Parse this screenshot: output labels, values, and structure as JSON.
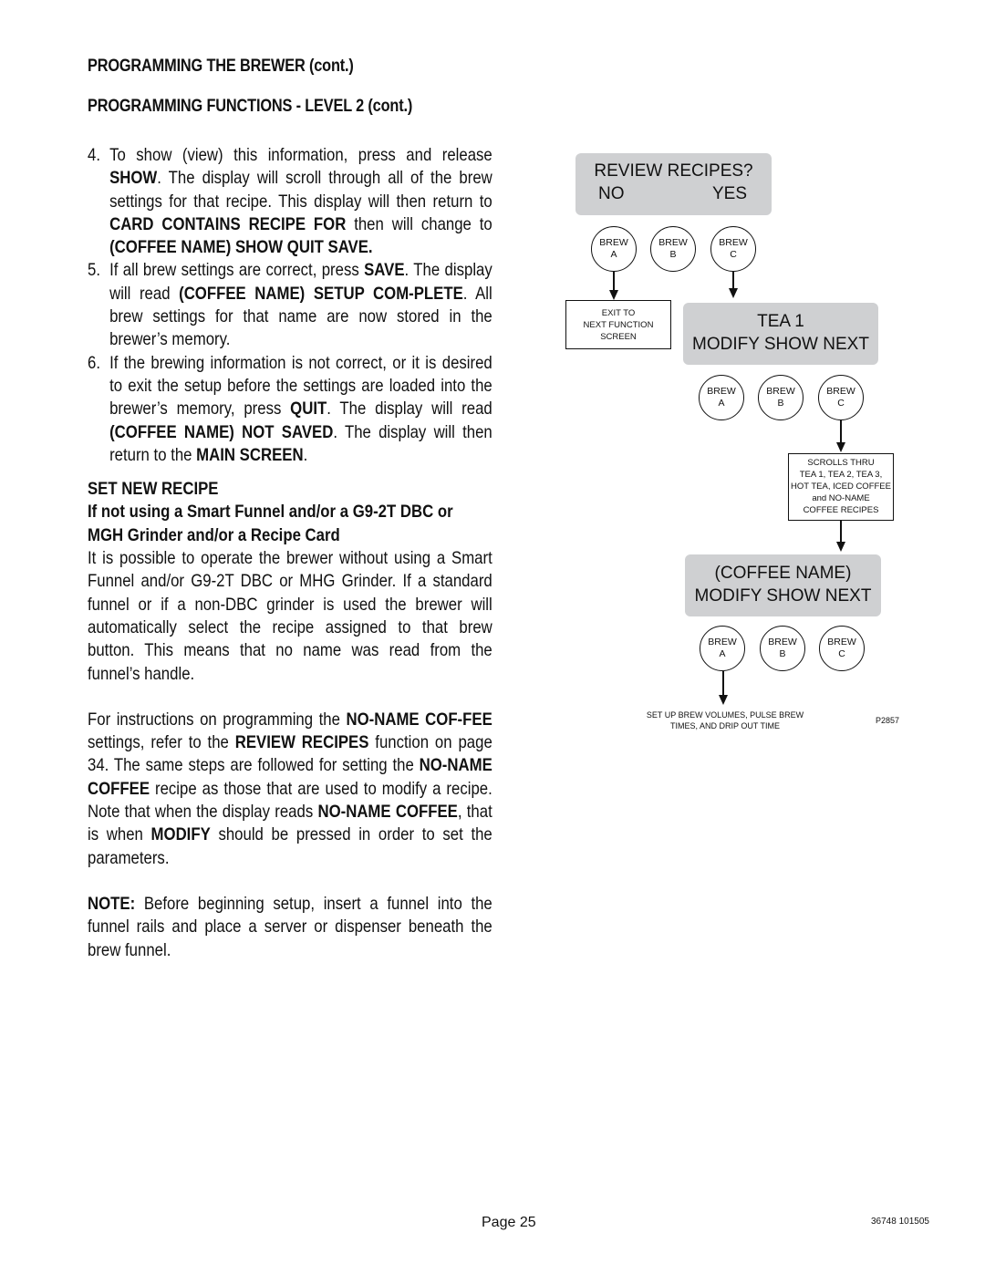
{
  "header": {
    "title": "PROGRAMMING THE BREWER (cont.)",
    "subtitle": "PROGRAMMING FUNCTIONS - LEVEL  2 (cont.)"
  },
  "steps": [
    {
      "num": "4.",
      "parts": [
        {
          "t": "To show (view) this information, press and release ",
          "b": false
        },
        {
          "t": "SHOW",
          "b": true
        },
        {
          "t": ".  The display will scroll through all of the brew settings for that recipe.  This display will then return to ",
          "b": false
        },
        {
          "t": "CARD CONTAINS RECIPE FOR",
          "b": true
        },
        {
          "t": " then will change to ",
          "b": false
        },
        {
          "t": "(COFFEE NAME) SHOW QUIT SAVE.",
          "b": true
        }
      ]
    },
    {
      "num": "5.",
      "parts": [
        {
          "t": "If all brew settings are correct, press ",
          "b": false
        },
        {
          "t": "SAVE",
          "b": true
        },
        {
          "t": ".  The display will read ",
          "b": false
        },
        {
          "t": "(COFFEE NAME) SETUP COM-PLETE",
          "b": true
        },
        {
          "t": ".  All brew settings for that name are now stored in the brewer’s memory.",
          "b": false
        }
      ]
    },
    {
      "num": "6.",
      "parts": [
        {
          "t": "If the brewing information is not correct, or it is desired to exit the setup before the settings are loaded into the brewer’s memory, press ",
          "b": false
        },
        {
          "t": "QUIT",
          "b": true
        },
        {
          "t": ".  The display will read ",
          "b": false
        },
        {
          "t": "(COFFEE NAME) NOT SAVED",
          "b": true
        },
        {
          "t": ".  The display will then return to the ",
          "b": false
        },
        {
          "t": "MAIN SCREEN",
          "b": true
        },
        {
          "t": ".",
          "b": false
        }
      ]
    }
  ],
  "set_new_recipe": {
    "heading": "SET NEW RECIPE",
    "subheading": "If not using a Smart Funnel and/or a G9-2T DBC or MGH Grinder and/or a Recipe Card",
    "para1": "It is possible to operate the brewer without using a Smart Funnel and/or G9-2T DBC or MHG Grinder.  If a standard funnel or if a non-DBC grinder is used the brewer will automatically select the recipe assigned to that brew button.  This means that no name was read from the funnel’s handle.",
    "para2_parts": [
      {
        "t": "For instructions on programming the ",
        "b": false
      },
      {
        "t": "NO-NAME COF-FEE",
        "b": true
      },
      {
        "t": " settings, refer to the ",
        "b": false
      },
      {
        "t": "REVIEW RECIPES",
        "b": true
      },
      {
        "t": " function on page 34.  The same steps are followed for setting the ",
        "b": false
      },
      {
        "t": "NO-NAME COFFEE",
        "b": true
      },
      {
        "t": " recipe as those that are used to modify a recipe.  Note that when the display reads ",
        "b": false
      },
      {
        "t": "NO-NAME COFFEE",
        "b": true
      },
      {
        "t": ", that is when ",
        "b": false
      },
      {
        "t": "MODIFY",
        "b": true
      },
      {
        "t": " should be pressed in order to set the parameters.",
        "b": false
      }
    ],
    "note_parts": [
      {
        "t": "NOTE:",
        "b": true
      },
      {
        "t": " Before beginning setup, insert a funnel into the funnel rails and place a server or dispenser beneath the brew funnel.",
        "b": false
      }
    ]
  },
  "diagram": {
    "review_screen": {
      "line1": "REVIEW RECIPES?",
      "no": "NO",
      "yes": "YES"
    },
    "brew_buttons": [
      {
        "top": "BREW",
        "bottom": "A"
      },
      {
        "top": "BREW",
        "bottom": "B"
      },
      {
        "top": "BREW",
        "bottom": "C"
      }
    ],
    "exit_box": [
      "EXIT TO",
      "NEXT FUNCTION",
      "SCREEN"
    ],
    "tea_screen": {
      "line1": "TEA 1",
      "line2": "MODIFY SHOW NEXT"
    },
    "scroll_box": [
      "SCROLLS THRU",
      "TEA 1, TEA 2, TEA 3,",
      "HOT TEA, ICED COFFEE",
      "and NO-NAME",
      "COFFEE RECIPES"
    ],
    "coffee_screen": {
      "line1": "(COFFEE NAME)",
      "line2": "MODIFY SHOW NEXT"
    },
    "setup_note": [
      "SET UP BREW VOLUMES, PULSE BREW",
      "TIMES, AND DRIP OUT TIME"
    ],
    "figure_id": "P2857"
  },
  "footer": {
    "page": "Page 25",
    "doc_code": "36748 101505"
  }
}
